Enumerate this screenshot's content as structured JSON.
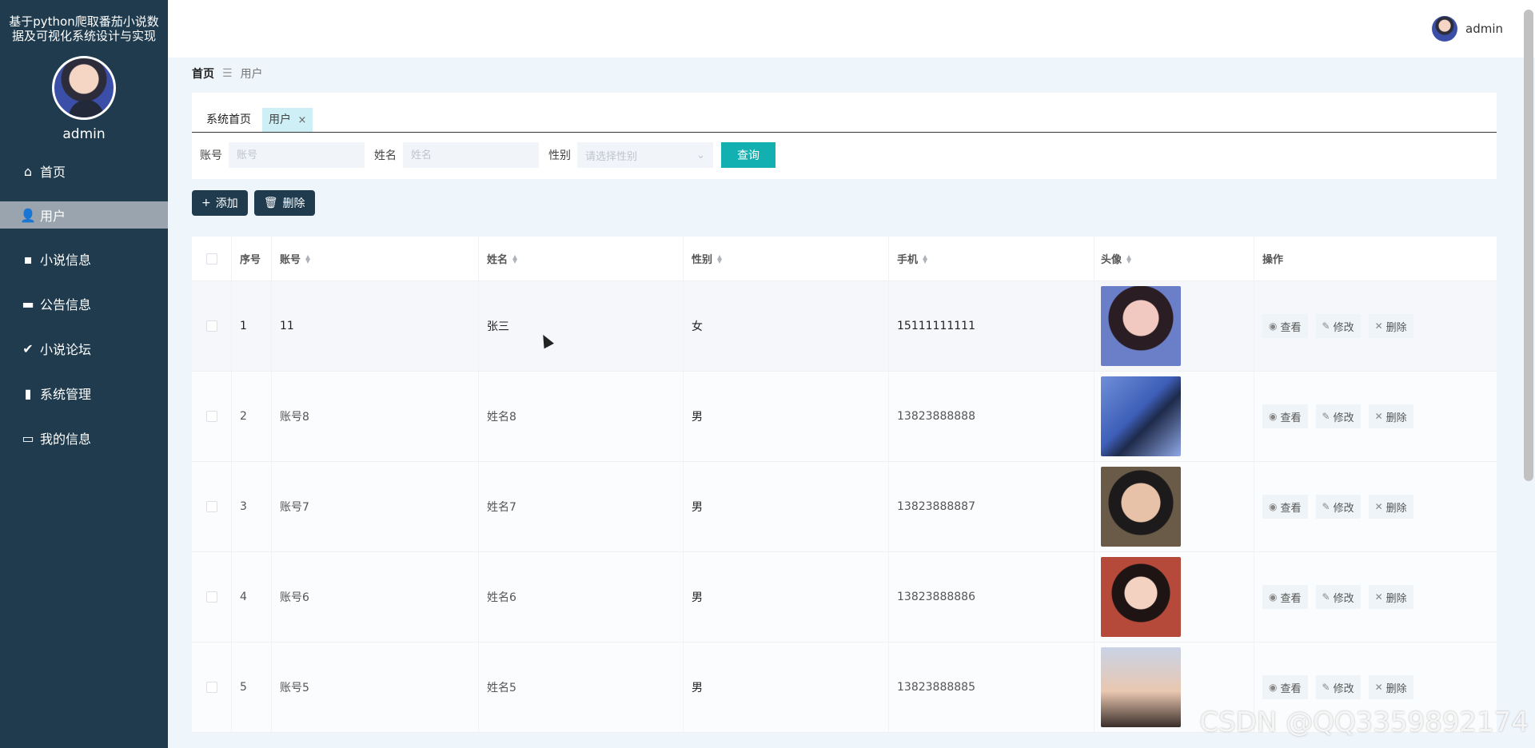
{
  "sidebar": {
    "app_title": "基于python爬取番茄小说数据及可视化系统设计与实现",
    "username": "admin",
    "items": [
      {
        "label": "首页",
        "icon": "home-icon"
      },
      {
        "label": "用户",
        "icon": "user-icon"
      },
      {
        "label": "小说信息",
        "icon": "chat-icon"
      },
      {
        "label": "公告信息",
        "icon": "inbox-icon"
      },
      {
        "label": "小说论坛",
        "icon": "clipboard-icon"
      },
      {
        "label": "系统管理",
        "icon": "bar-chart-icon"
      },
      {
        "label": "我的信息",
        "icon": "card-icon"
      }
    ],
    "active_index": 1,
    "colors": {
      "background": "#1f3b4d",
      "active": "#9aa4ae"
    }
  },
  "topbar": {
    "username": "admin"
  },
  "breadcrumb": {
    "home": "首页",
    "separator": "☰",
    "current": "用户"
  },
  "tabs": [
    {
      "label": "系统首页"
    },
    {
      "label": "用户",
      "close": "×"
    }
  ],
  "search": {
    "account_label": "账号",
    "account_placeholder": "账号",
    "name_label": "姓名",
    "name_placeholder": "姓名",
    "gender_label": "性别",
    "gender_placeholder": "请选择性别",
    "query_button": "查询",
    "accent_color": "#12b0b0"
  },
  "actions": {
    "add_label": "添加",
    "delete_label": "删除"
  },
  "table": {
    "columns": [
      "序号",
      "账号",
      "姓名",
      "性别",
      "手机",
      "头像",
      "操作"
    ],
    "rows": [
      {
        "index": "1",
        "account": "11",
        "name": "张三",
        "gender": "女",
        "phone": "15111111111"
      },
      {
        "index": "2",
        "account": "账号8",
        "name": "姓名8",
        "gender": "男",
        "phone": "13823888888"
      },
      {
        "index": "3",
        "account": "账号7",
        "name": "姓名7",
        "gender": "男",
        "phone": "13823888887"
      },
      {
        "index": "4",
        "account": "账号6",
        "name": "姓名6",
        "gender": "男",
        "phone": "13823888886"
      },
      {
        "index": "5",
        "account": "账号5",
        "name": "姓名5",
        "gender": "男",
        "phone": "13823888885"
      }
    ],
    "row_ops": {
      "view": "查看",
      "edit": "修改",
      "delete": "删除"
    }
  },
  "watermark": "CSDN @QQ3359892174"
}
